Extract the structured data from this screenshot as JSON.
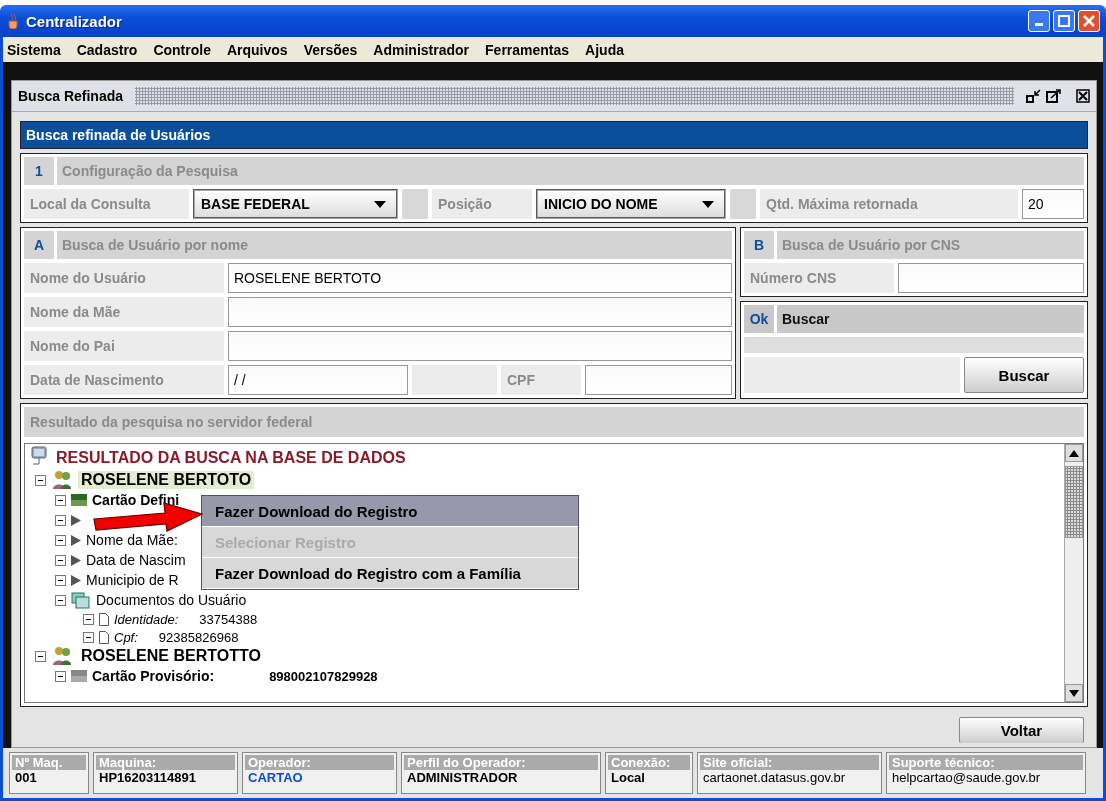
{
  "window": {
    "title": "Centralizador"
  },
  "menu": [
    "Sistema",
    "Cadastro",
    "Controle",
    "Arquivos",
    "Versões",
    "Administrador",
    "Ferramentas",
    "Ajuda"
  ],
  "frame": {
    "title": "Busca Refinada"
  },
  "panel": {
    "title": "Busca refinada de Usuários",
    "config": {
      "number": "1",
      "title": "Configuração da Pesquisa",
      "local_label": "Local da Consulta",
      "local_value": "BASE FEDERAL",
      "posicao_label": "Posição",
      "posicao_value": "INICIO DO NOME",
      "qtd_label": "Qtd. Máxima retornada",
      "qtd_value": "20"
    },
    "by_name": {
      "letter": "A",
      "title": "Busca de Usuário por nome",
      "fields": [
        {
          "label": "Nome do Usuário",
          "value": "ROSELENE BERTOTO"
        },
        {
          "label": "Nome da Mãe"
        },
        {
          "label": "Nome do Pai"
        }
      ],
      "birth_label": "Data de Nascimento",
      "birth_value": "/ /",
      "cpf_label": "CPF"
    },
    "by_cns": {
      "letter": "B",
      "title": "Busca de Usuário por CNS",
      "cns_label": "Número CNS"
    },
    "ok": {
      "letter": "Ok",
      "title": "Buscar",
      "button": "Buscar"
    },
    "results": {
      "title": "Resultado da pesquisa no servidor federal",
      "root": "RESULTADO DA BUSCA NA BASE DE DADOS",
      "records": [
        {
          "name": "ROSELENE BERTOTO",
          "selected": true,
          "children": [
            {
              "kind": "card",
              "label": "Cartão Defini"
            },
            {
              "kind": "field"
            },
            {
              "kind": "field",
              "label": "Nome da Mãe:"
            },
            {
              "kind": "field",
              "label": "Data de Nascim"
            },
            {
              "kind": "field",
              "label": "Municipio de R"
            },
            {
              "kind": "docs",
              "label": "Documentos do Usuário",
              "children": [
                {
                  "label": "Identidade:",
                  "value": "33754388"
                },
                {
                  "label": "Cpf:",
                  "value": "92385826968"
                }
              ]
            }
          ]
        },
        {
          "name": "ROSELENE BERTOTTO",
          "selected": false,
          "children": [
            {
              "kind": "card-temp",
              "label": "Cartão Provisório:",
              "value": "898002107829928"
            }
          ]
        }
      ]
    },
    "context_menu": [
      {
        "label": "Fazer Download do Registro",
        "selected": true,
        "disabled": false
      },
      {
        "label": "Selecionar Registro",
        "selected": false,
        "disabled": true
      },
      {
        "label": "Fazer Download do Registro com a Família",
        "selected": false,
        "disabled": false
      }
    ],
    "back_button": "Voltar"
  },
  "status_bar": [
    {
      "label": "Nº Maq.",
      "value": "001",
      "kind": "bold"
    },
    {
      "label": "Maquina:",
      "value": "HP16203114891",
      "kind": "bold"
    },
    {
      "label": "Operador:",
      "value": "CARTAO",
      "kind": "highlight"
    },
    {
      "label": "Perfil do Operador:",
      "value": "ADMINISTRADOR",
      "kind": "bold"
    },
    {
      "label": "Conexão:",
      "value": "Local",
      "kind": "bold"
    },
    {
      "label": "Site oficial:",
      "value": "cartaonet.datasus.gov.br",
      "kind": "plain"
    },
    {
      "label": "Suporte técnico:",
      "value": "helpcartao@saude.gov.br",
      "kind": "plain"
    }
  ]
}
